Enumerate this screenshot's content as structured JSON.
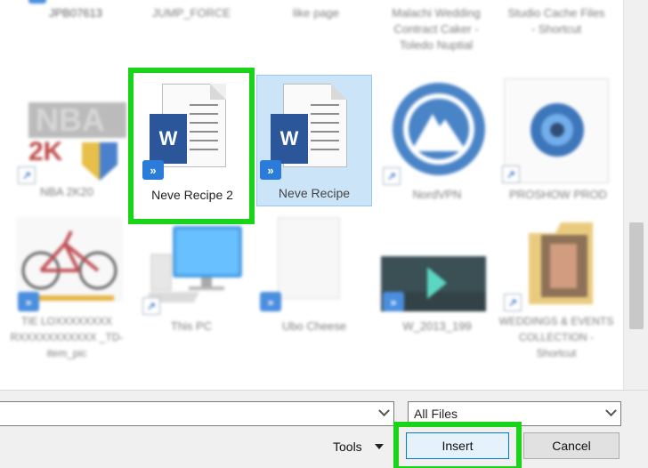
{
  "top_row_labels": [
    "JPB07613",
    "JUMP_FORCE",
    "like page",
    "Malachi Wedding Contract Caker - Toledo Nuptial",
    "Studio Cache Files - Shortcut"
  ],
  "row1": [
    {
      "label": "NBA 2K20",
      "icon": "nba2k-icon"
    },
    {
      "label": "Neve Recipe 2",
      "icon": "word-doc-icon",
      "badge": "onedrive-sync-icon"
    },
    {
      "label": "Neve Recipe",
      "icon": "word-doc-icon",
      "badge": "onedrive-sync-icon"
    },
    {
      "label": "NordVPN",
      "icon": "nordvpn-icon",
      "badge": "shortcut-arrow-icon"
    },
    {
      "label": "PROSHOW PROD",
      "icon": "proshow-icon",
      "badge": "shortcut-arrow-icon"
    }
  ],
  "row2": [
    {
      "label": "TIE LOXXXXXXXX RXXXXXXXXXXX _TD-item_pic",
      "icon": "bicycle-icon"
    },
    {
      "label": "This PC",
      "icon": "computer-icon",
      "badge": "shortcut-arrow-icon"
    },
    {
      "label": "Ubo Cheese",
      "icon": "blank-file-icon"
    },
    {
      "label": "W_2013_199",
      "icon": "video-thumbnail-icon"
    },
    {
      "label": "WEDDINGS & EVENTS COLLECTION - Shortcut",
      "icon": "folder-icon",
      "badge": "shortcut-arrow-icon"
    }
  ],
  "word_icon_letter": "W",
  "onedrive_glyph": "»",
  "shortcut_glyph": "↗",
  "filename_field": {
    "value": ""
  },
  "filetype_select": {
    "value": "All Files"
  },
  "buttons": {
    "tools": "Tools",
    "insert": "Insert",
    "cancel": "Cancel"
  },
  "colors": {
    "highlight": "#19d419",
    "selection": "#cce4f7",
    "word_blue": "#2b579a",
    "onedrive_blue": "#2b7bd9"
  }
}
